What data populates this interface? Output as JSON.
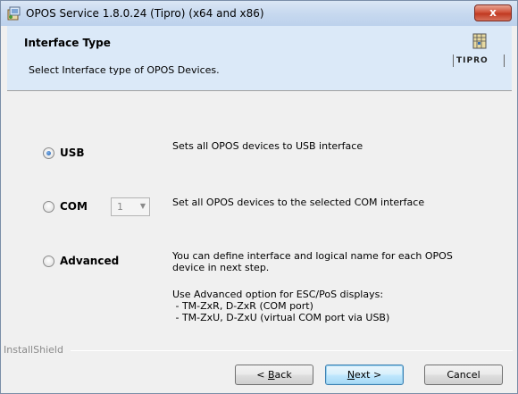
{
  "window": {
    "title": "OPOS Service 1.8.0.24 (Tipro) (x64 and x86)",
    "close_label": "x"
  },
  "banner": {
    "heading": "Interface Type",
    "subtitle": "Select Interface type of OPOS Devices.",
    "logo_text": "TIPRO"
  },
  "options": {
    "usb": {
      "label": "USB",
      "checked": true,
      "description": "Sets all OPOS devices to USB interface"
    },
    "com": {
      "label": "COM",
      "checked": false,
      "select_value": "1",
      "description": "Set all OPOS devices to the selected COM interface"
    },
    "advanced": {
      "label": "Advanced",
      "checked": false,
      "description_line1": "You can define interface and logical name for each OPOS",
      "description_line2": "device in next step.",
      "note_line1": "Use Advanced option for ESC/PoS displays:",
      "note_line2": " - TM-ZxR, D-ZxR (COM port)",
      "note_line3": " - TM-ZxU, D-ZxU (virtual COM port via USB)"
    }
  },
  "footer": {
    "installshield": "InstallShield",
    "back_prefix": "< ",
    "back_accel": "B",
    "back_rest": "ack",
    "next_accel": "N",
    "next_rest": "ext >",
    "cancel_label": "Cancel"
  },
  "colors": {
    "banner_bg": "#dbe9f8",
    "radio_selected": "#1f5fb0",
    "close_button": "#c13a22"
  }
}
